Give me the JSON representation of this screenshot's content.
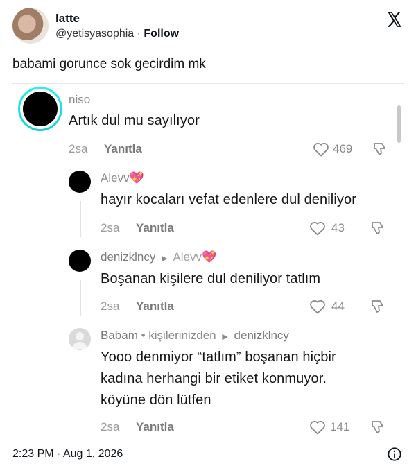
{
  "post": {
    "display_name": "latte",
    "handle": "@yetisyasophia",
    "separator": " · ",
    "follow_label": "Follow",
    "text": "babami gorunce sok gecirdim mk",
    "timestamp": "2:23 PM · Aug 1, 2026"
  },
  "comments": [
    {
      "author": "niso",
      "text": "Artık dul mu sayılıyor",
      "time": "2sa",
      "reply_label": "Yanıtla",
      "likes": "469"
    },
    {
      "author": "Alevv",
      "emoji": "💖",
      "text": "hayır kocaları vefat edenlere dul deniliyor",
      "time": "2sa",
      "reply_label": "Yanıtla",
      "likes": "43"
    },
    {
      "author": "denizklncy",
      "reply_to": "Alevv",
      "emoji": "💖",
      "text": "Boşanan kişilere dul deniliyor tatlım",
      "time": "2sa",
      "reply_label": "Yanıtla",
      "likes": "44"
    },
    {
      "author": "Babam",
      "author_suffix": "• kişilerinizden",
      "reply_to": "denizklncy",
      "text_lines": [
        "Yooo denmiyor “tatlım” boşanan hiçbir",
        "kadına herhangi bir etiket konmuyor.",
        "köyüne dön lütfen"
      ],
      "time": "2sa",
      "reply_label": "Yanıtla",
      "likes": "141"
    }
  ],
  "colors": {
    "ring": "#25f4ee",
    "text": "#0f1419",
    "muted": "#8a8a8a"
  },
  "icons": [
    "x-logo-icon",
    "heart-icon",
    "dislike-icon",
    "play-arrow-icon",
    "info-icon",
    "default-avatar-icon"
  ]
}
